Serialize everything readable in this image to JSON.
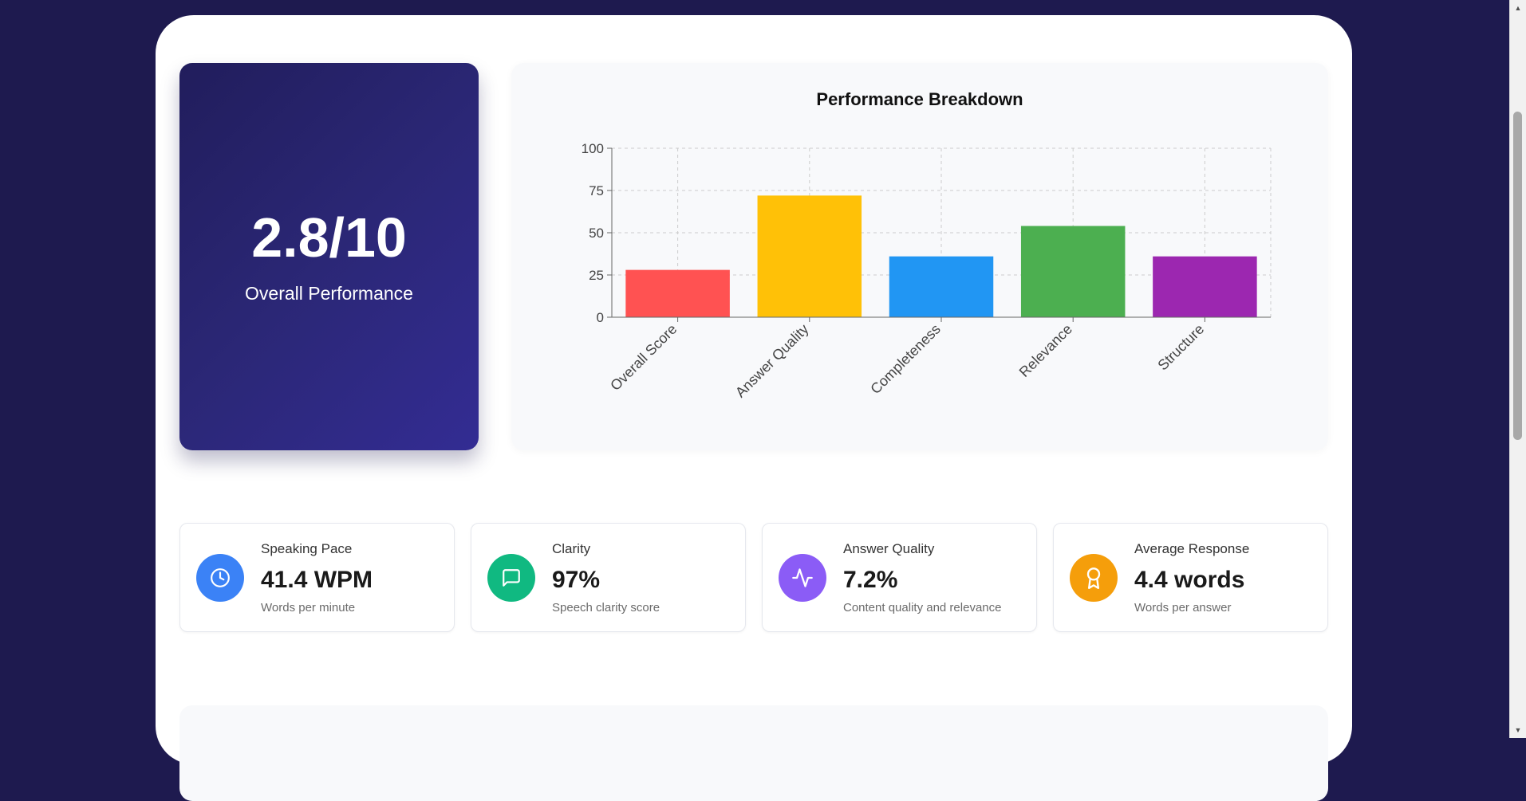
{
  "score_card": {
    "value": "2.8/10",
    "label": "Overall Performance"
  },
  "chart_data": {
    "type": "bar",
    "title": "Performance Breakdown",
    "categories": [
      "Overall Score",
      "Answer Quality",
      "Completeness",
      "Relevance",
      "Structure"
    ],
    "values": [
      28,
      72,
      36,
      54,
      36
    ],
    "colors": [
      "#ff5252",
      "#ffc107",
      "#2196f3",
      "#4caf50",
      "#9c27b0"
    ],
    "ylim": [
      0,
      100
    ],
    "yticks": [
      0,
      25,
      50,
      75,
      100
    ],
    "grid": true,
    "xlabel": "",
    "ylabel": ""
  },
  "metrics": [
    {
      "title": "Speaking Pace",
      "value": "41.4 WPM",
      "subtitle": "Words per minute",
      "icon": "clock-icon",
      "color": "#3b82f6"
    },
    {
      "title": "Clarity",
      "value": "97%",
      "subtitle": "Speech clarity score",
      "icon": "message-icon",
      "color": "#10b981"
    },
    {
      "title": "Answer Quality",
      "value": "7.2%",
      "subtitle": "Content quality and relevance",
      "icon": "activity-icon",
      "color": "#8b5cf6"
    },
    {
      "title": "Average Response",
      "value": "4.4 words",
      "subtitle": "Words per answer",
      "icon": "award-icon",
      "color": "#f59e0b"
    }
  ]
}
